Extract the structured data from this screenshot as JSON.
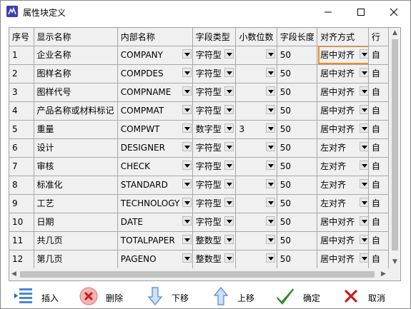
{
  "window": {
    "title": "属性块定义"
  },
  "columns": [
    "序号",
    "显示名称",
    "内部名称",
    "字段类型",
    "小数位数",
    "字段长度",
    "对齐方式",
    "行"
  ],
  "rows": [
    {
      "no": "1",
      "display": "企业名称",
      "internal": "COMPANY",
      "type": "字符型",
      "decimals": "",
      "length": "50",
      "align": "居中对齐",
      "row": "自"
    },
    {
      "no": "2",
      "display": "图样名称",
      "internal": "COMPDES",
      "type": "字符型",
      "decimals": "",
      "length": "50",
      "align": "居中对齐",
      "row": "自"
    },
    {
      "no": "3",
      "display": "图样代号",
      "internal": "COMPNAME",
      "type": "字符型",
      "decimals": "",
      "length": "50",
      "align": "居中对齐",
      "row": "自"
    },
    {
      "no": "4",
      "display": "产品名称或材料标记",
      "internal": "COMPMAT",
      "type": "字符型",
      "decimals": "",
      "length": "50",
      "align": "居中对齐",
      "row": "自"
    },
    {
      "no": "5",
      "display": "重量",
      "internal": "COMPWT",
      "type": "数字型",
      "decimals": "3",
      "length": "50",
      "align": "居中对齐",
      "row": "自"
    },
    {
      "no": "6",
      "display": "设计",
      "internal": "DESIGNER",
      "type": "字符型",
      "decimals": "",
      "length": "50",
      "align": "左对齐",
      "row": "自"
    },
    {
      "no": "7",
      "display": "审核",
      "internal": "CHECK",
      "type": "字符型",
      "decimals": "",
      "length": "50",
      "align": "左对齐",
      "row": "自"
    },
    {
      "no": "8",
      "display": "标准化",
      "internal": "STANDARD",
      "type": "字符型",
      "decimals": "",
      "length": "50",
      "align": "左对齐",
      "row": "自"
    },
    {
      "no": "9",
      "display": "工艺",
      "internal": "TECHNOLOGY",
      "type": "字符型",
      "decimals": "",
      "length": "50",
      "align": "左对齐",
      "row": "自"
    },
    {
      "no": "10",
      "display": "日期",
      "internal": "DATE",
      "type": "字符型",
      "decimals": "",
      "length": "50",
      "align": "居中对齐",
      "row": "自"
    },
    {
      "no": "11",
      "display": "共几页",
      "internal": "TOTALPAPER",
      "type": "整数型",
      "decimals": "",
      "length": "50",
      "align": "居中对齐",
      "row": "自"
    },
    {
      "no": "12",
      "display": "第几页",
      "internal": "PAGENO",
      "type": "整数型",
      "decimals": "",
      "length": "50",
      "align": "居中对齐",
      "row": "自"
    }
  ],
  "toolbar": {
    "insert": "插入",
    "delete": "删除",
    "move_down": "下移",
    "move_up": "上移",
    "ok": "确定",
    "cancel": "取消"
  },
  "colors": {
    "highlight": "#f08a24",
    "accept": "#2e8b2e",
    "cancel": "#c81e1e",
    "arrow": "#4a86d8"
  }
}
